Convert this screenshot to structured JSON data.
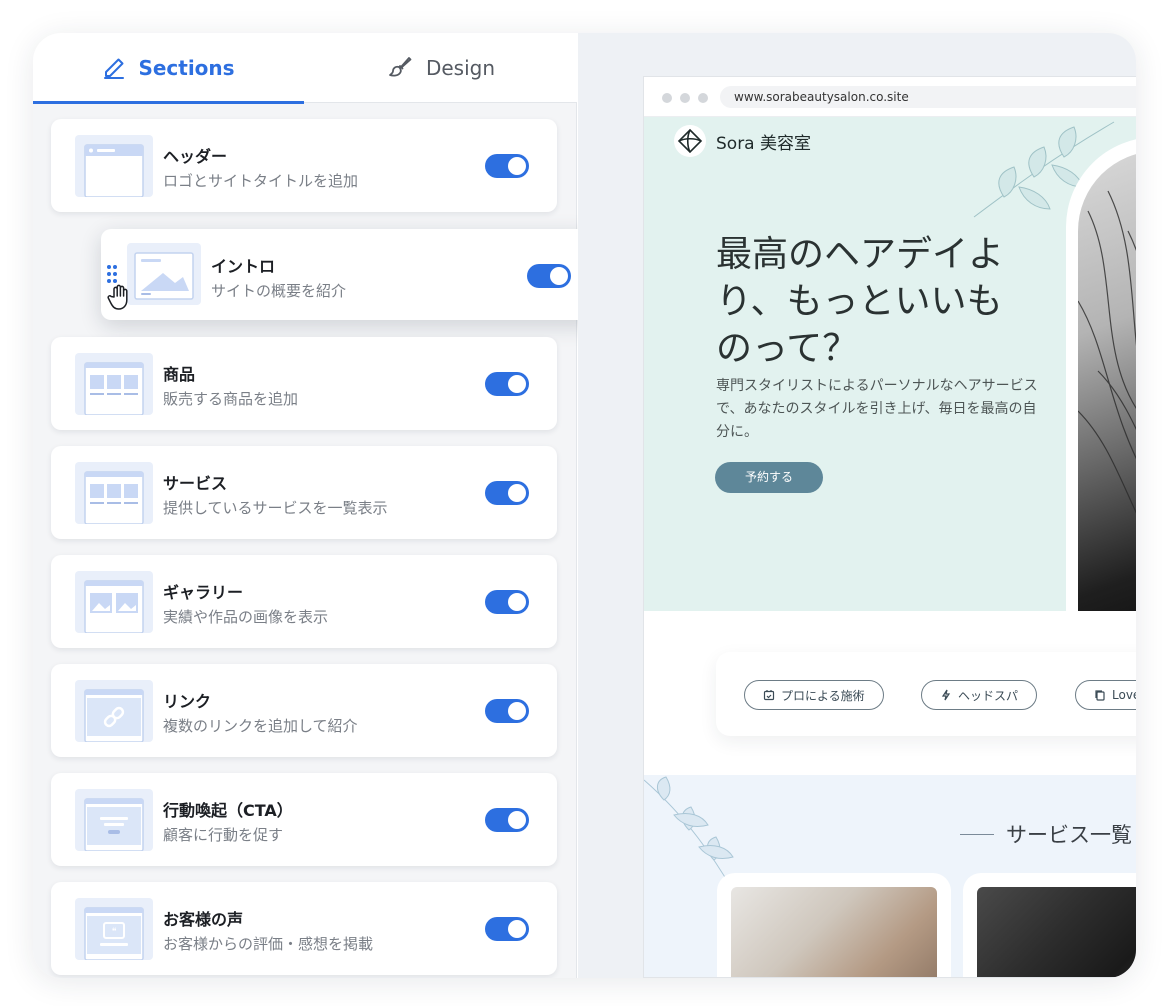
{
  "tabs": [
    {
      "label": "Sections",
      "icon": "pencil-icon",
      "active": true
    },
    {
      "label": "Design",
      "icon": "paintbrush-icon",
      "active": false
    }
  ],
  "sections": [
    {
      "title": "ヘッダー",
      "description": "ロゴとサイトタイトルを追加",
      "enabled": true
    },
    {
      "title": "イントロ",
      "description": "サイトの概要を紹介",
      "enabled": true,
      "dragging": true
    },
    {
      "title": "商品",
      "description": "販売する商品を追加",
      "enabled": true
    },
    {
      "title": "サービス",
      "description": "提供しているサービスを一覧表示",
      "enabled": true
    },
    {
      "title": "ギャラリー",
      "description": "実績や作品の画像を表示",
      "enabled": true
    },
    {
      "title": "リンク",
      "description": "複数のリンクを追加して紹介",
      "enabled": true
    },
    {
      "title": "行動喚起（CTA）",
      "description": "顧客に行動を促す",
      "enabled": true
    },
    {
      "title": "お客様の声",
      "description": "お客様からの評価・感想を掲載",
      "enabled": true
    }
  ],
  "preview": {
    "url": "www.sorabeautysalon.co.site",
    "brand": "Sora 美容室",
    "headline": "最高のヘアデイより、もっといいものって？",
    "subtext": "専門スタイリストによるパーソナルなヘアサービスで、あなたのスタイルを引き上げ、毎日を最高の自分に。",
    "cta": "予約する",
    "pills": [
      "プロによる施術",
      "ヘッドスパ",
      "Love"
    ],
    "services_title": "サービス一覧"
  },
  "colors": {
    "accent": "#2d6fe0",
    "hero_bg": "#e2f2ef",
    "cta_bg": "#5e8799",
    "services_bg": "#eef4fb"
  }
}
